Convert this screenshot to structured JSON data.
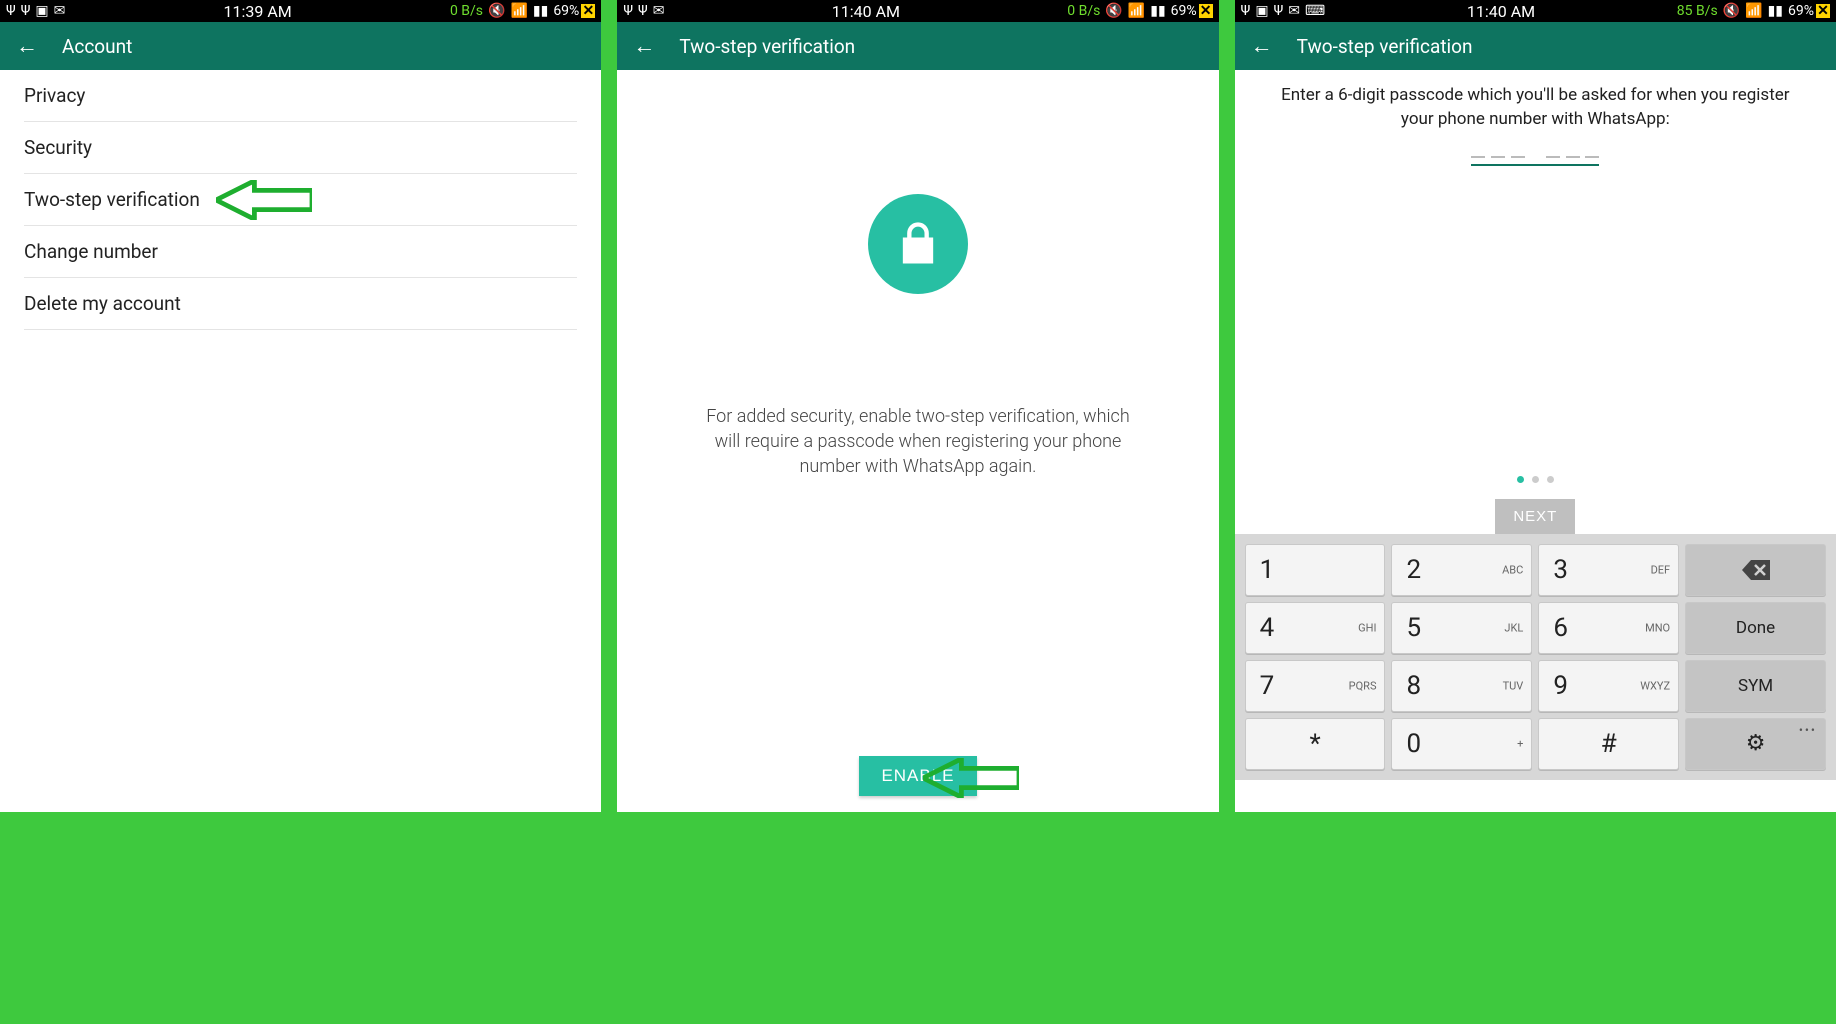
{
  "screens": [
    {
      "status": {
        "time": "11:39 AM",
        "netSpeed": "0 B/s",
        "battery": "69%"
      },
      "title": "Account",
      "list": [
        "Privacy",
        "Security",
        "Two-step verification",
        "Change number",
        "Delete my account"
      ]
    },
    {
      "status": {
        "time": "11:40 AM",
        "netSpeed": "0 B/s",
        "battery": "69%"
      },
      "title": "Two-step verification",
      "desc": "For added security, enable two-step verification, which will require a passcode when registering your phone number with WhatsApp again.",
      "enable": "ENABLE"
    },
    {
      "status": {
        "time": "11:40 AM",
        "netSpeed": "85 B/s",
        "battery": "69%"
      },
      "title": "Two-step verification",
      "prompt": "Enter a 6-digit passcode which you'll be asked for when you register your phone number with WhatsApp:",
      "next": "NEXT",
      "keys": [
        {
          "n": "1",
          "s": ""
        },
        {
          "n": "2",
          "s": "ABC"
        },
        {
          "n": "3",
          "s": "DEF"
        },
        {
          "fn": "backspace"
        },
        {
          "n": "4",
          "s": "GHI"
        },
        {
          "n": "5",
          "s": "JKL"
        },
        {
          "n": "6",
          "s": "MNO"
        },
        {
          "fn": "Done"
        },
        {
          "n": "7",
          "s": "PQRS"
        },
        {
          "n": "8",
          "s": "TUV"
        },
        {
          "n": "9",
          "s": "WXYZ"
        },
        {
          "fn": "SYM"
        },
        {
          "n": "*",
          "s": "",
          "center": true
        },
        {
          "n": "0",
          "s": "+"
        },
        {
          "n": "#",
          "s": "",
          "center": true
        },
        {
          "fn": "gear"
        }
      ]
    }
  ]
}
